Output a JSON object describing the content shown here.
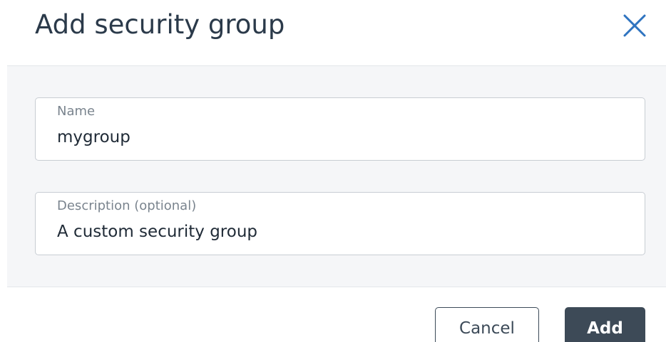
{
  "dialog": {
    "title": "Add security group",
    "close_icon": "close-icon"
  },
  "form": {
    "name": {
      "label": "Name",
      "value": "mygroup"
    },
    "description": {
      "label": "Description (optional)",
      "value": "A custom security group"
    }
  },
  "footer": {
    "cancel_label": "Cancel",
    "add_label": "Add"
  },
  "colors": {
    "accent": "#2f74c0",
    "primary_button": "#3d4a57",
    "body_background": "#f5f6f8"
  }
}
